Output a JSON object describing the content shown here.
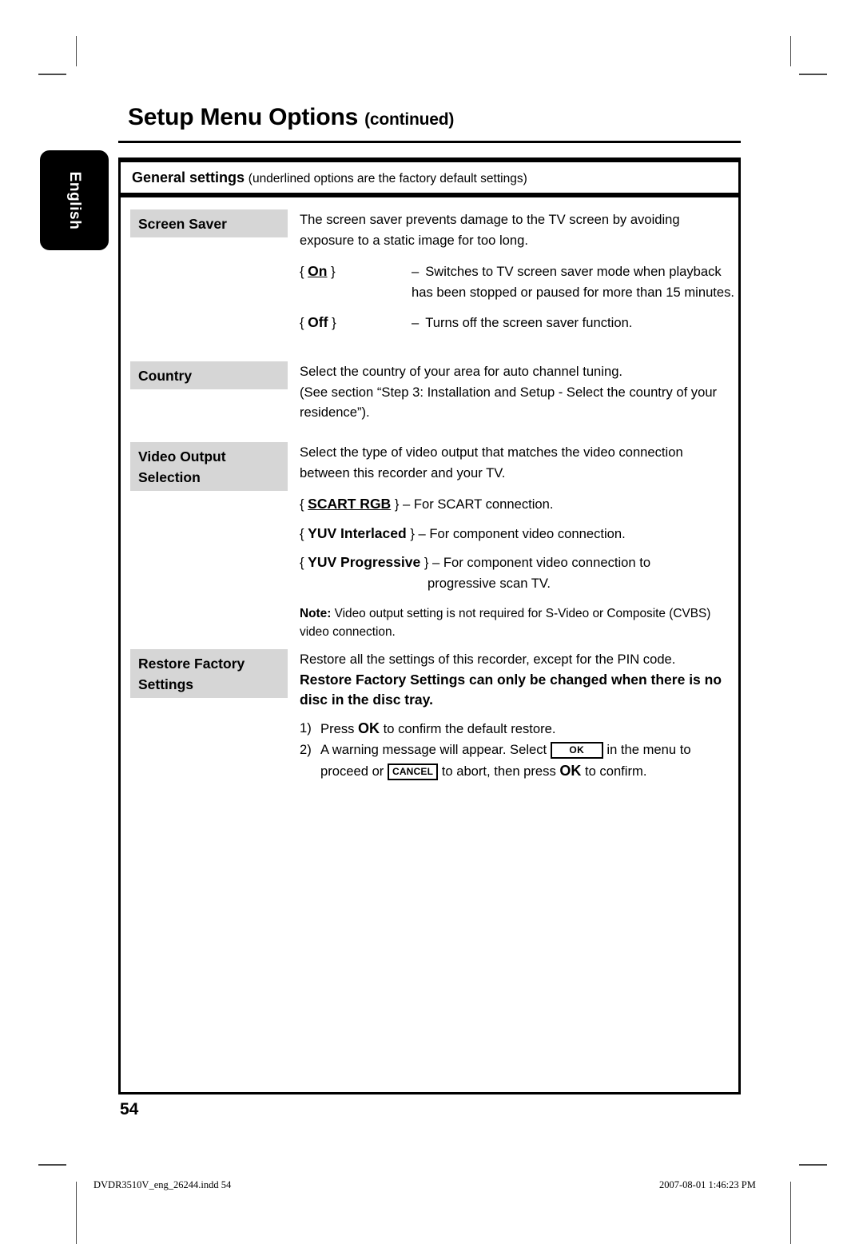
{
  "language_tab": "English",
  "header": {
    "title": "Setup Menu Options",
    "title_suffix": "(continued)"
  },
  "table_header": {
    "bold": "General settings",
    "note": "(underlined options are the factory default settings)"
  },
  "rows": [
    {
      "label_lines": [
        "Screen Saver"
      ],
      "intro": "The screen saver prevents damage to the TV screen by avoiding exposure to a static image for too long.",
      "options": [
        {
          "key_open": "{",
          "key": "On",
          "key_close": "}",
          "underlined": true,
          "dash": "–",
          "desc": "Switches to TV screen saver mode when playback has been stopped or paused for more than 15 minutes."
        },
        {
          "key_open": "{",
          "key": "Off",
          "key_close": "}",
          "underlined": false,
          "dash": "–",
          "desc": "Turns off the screen saver function."
        }
      ]
    },
    {
      "label_lines": [
        "Country"
      ],
      "paragraphs": [
        "Select the country of your area for auto channel tuning.",
        "(See section “Step 3: Installation and Setup - Select the country of your residence”)."
      ]
    },
    {
      "label_lines": [
        "Video Output",
        "Selection"
      ],
      "intro": "Select the type of video output that matches the video connection between this recorder and your TV.",
      "inline_options": [
        {
          "key_open": "{",
          "key": "SCART RGB",
          "key_close": "}",
          "underlined": true,
          "dash": "–",
          "desc": "For SCART connection.",
          "desc_cont": ""
        },
        {
          "key_open": "{",
          "key": "YUV Interlaced",
          "key_close": "}",
          "underlined": false,
          "dash": "–",
          "desc": "For component video connection.",
          "desc_cont": ""
        },
        {
          "key_open": "{",
          "key": "YUV Progressive",
          "key_close": "}",
          "underlined": false,
          "dash": "–",
          "desc": "For component video connection to",
          "desc_cont": "progressive scan TV."
        }
      ],
      "note": {
        "label": "Note:",
        "text": "Video output setting is not required for S-Video or Composite (CVBS) video connection."
      }
    },
    {
      "label_lines": [
        "Restore Factory",
        "Settings"
      ],
      "intro": "Restore all the settings of this recorder, except for the PIN code.",
      "warning": "Restore Factory Settings can only be changed when there is no disc in the disc tray.",
      "steps": [
        {
          "marker": "1)",
          "parts": [
            {
              "type": "text",
              "value": "Press "
            },
            {
              "type": "bold",
              "value": "OK"
            },
            {
              "type": "text",
              "value": " to confirm the default restore."
            }
          ]
        },
        {
          "marker": "2)",
          "parts": [
            {
              "type": "text",
              "value": "A warning message will appear.  Select "
            },
            {
              "type": "keycap-ok",
              "value": "OK"
            },
            {
              "type": "text",
              "value": " in the menu to proceed or "
            },
            {
              "type": "keycap-cancel",
              "value": "CANCEL"
            },
            {
              "type": "text",
              "value": " to abort, then press "
            },
            {
              "type": "bold",
              "value": "OK"
            },
            {
              "type": "text",
              "value": " to confirm."
            }
          ]
        }
      ]
    }
  ],
  "page_number": "54",
  "footer": {
    "file": "DVDR3510V_eng_26244.indd   54",
    "timestamp": "2007-08-01   1:46:23 PM"
  }
}
